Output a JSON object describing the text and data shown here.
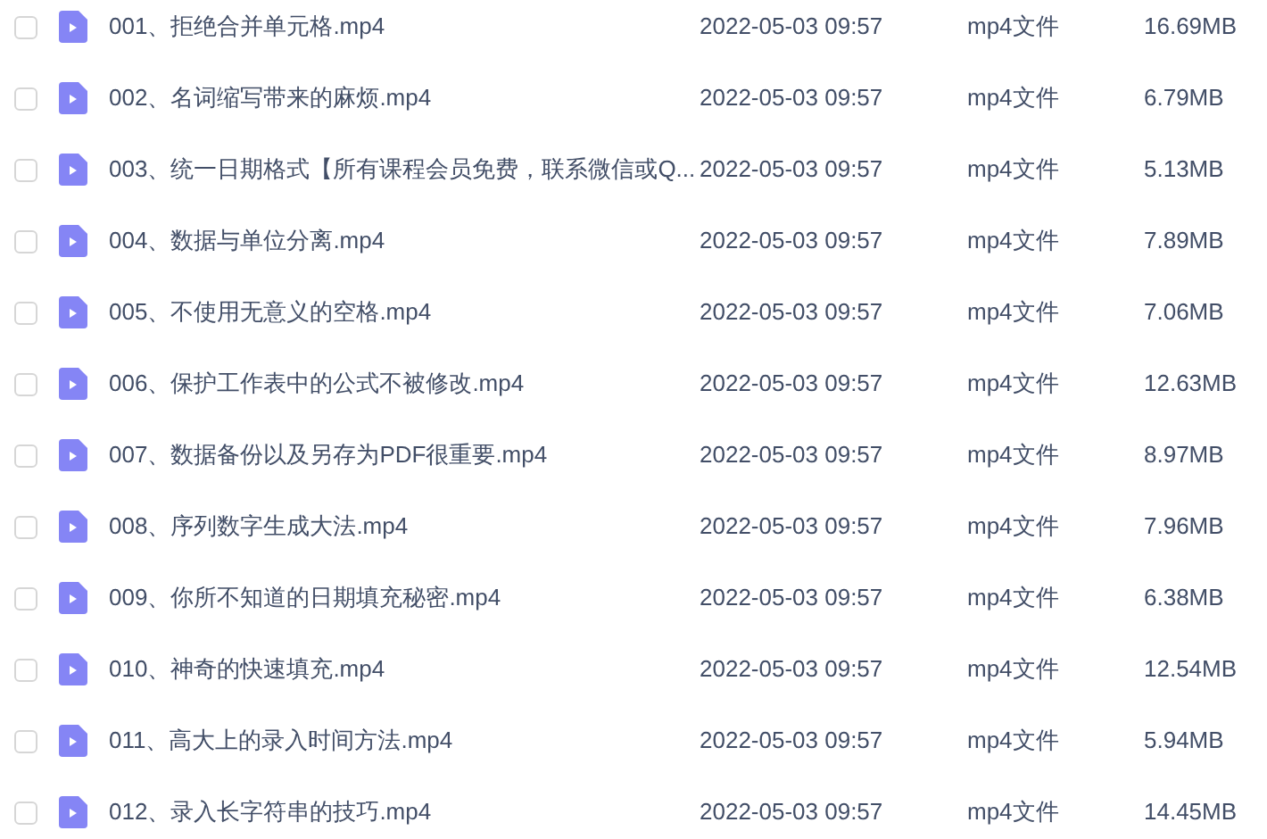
{
  "files": [
    {
      "name": "001、拒绝合并单元格.mp4",
      "date": "2022-05-03 09:57",
      "type": "mp4文件",
      "size": "16.69MB",
      "checked": false
    },
    {
      "name": "002、名词缩写带来的麻烦.mp4",
      "date": "2022-05-03 09:57",
      "type": "mp4文件",
      "size": "6.79MB",
      "checked": false
    },
    {
      "name": "003、统一日期格式【所有课程会员免费，联系微信或Q...",
      "date": "2022-05-03 09:57",
      "type": "mp4文件",
      "size": "5.13MB",
      "checked": false
    },
    {
      "name": "004、数据与单位分离.mp4",
      "date": "2022-05-03 09:57",
      "type": "mp4文件",
      "size": "7.89MB",
      "checked": false
    },
    {
      "name": "005、不使用无意义的空格.mp4",
      "date": "2022-05-03 09:57",
      "type": "mp4文件",
      "size": "7.06MB",
      "checked": false
    },
    {
      "name": "006、保护工作表中的公式不被修改.mp4",
      "date": "2022-05-03 09:57",
      "type": "mp4文件",
      "size": "12.63MB",
      "checked": false
    },
    {
      "name": "007、数据备份以及另存为PDF很重要.mp4",
      "date": "2022-05-03 09:57",
      "type": "mp4文件",
      "size": "8.97MB",
      "checked": false
    },
    {
      "name": "008、序列数字生成大法.mp4",
      "date": "2022-05-03 09:57",
      "type": "mp4文件",
      "size": "7.96MB",
      "checked": false
    },
    {
      "name": "009、你所不知道的日期填充秘密.mp4",
      "date": "2022-05-03 09:57",
      "type": "mp4文件",
      "size": "6.38MB",
      "checked": false
    },
    {
      "name": "010、神奇的快速填充.mp4",
      "date": "2022-05-03 09:57",
      "type": "mp4文件",
      "size": "12.54MB",
      "checked": false
    },
    {
      "name": "011、高大上的录入时间方法.mp4",
      "date": "2022-05-03 09:57",
      "type": "mp4文件",
      "size": "5.94MB",
      "checked": false
    },
    {
      "name": "012、录入长字符串的技巧.mp4",
      "date": "2022-05-03 09:57",
      "type": "mp4文件",
      "size": "14.45MB",
      "checked": false
    }
  ]
}
